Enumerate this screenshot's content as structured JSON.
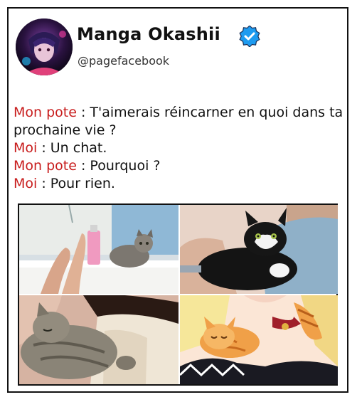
{
  "profile": {
    "name": "Manga Okashii",
    "handle": "@pagefacebook",
    "verified_icon": "verified-badge-icon",
    "avatar": "anime-character-avatar"
  },
  "post": {
    "lines": [
      {
        "speaker": "Mon pote",
        "text": " : T'aimerais réincarner en quoi dans ta prochaine vie ?"
      },
      {
        "speaker": "Moi",
        "text": " : Un chat."
      },
      {
        "speaker": "Mon pote",
        "text": " : Pourquoi ?"
      },
      {
        "speaker": "Moi",
        "text": " : Pour rien."
      }
    ]
  },
  "colors": {
    "speaker": "#c81d1d",
    "verified": "#1d9bf0",
    "text": "#111111"
  },
  "images": [
    {
      "name": "cat-in-bathtub-photo"
    },
    {
      "name": "cat-in-shirt-photo"
    },
    {
      "name": "cat-on-chest-photo"
    },
    {
      "name": "anime-cat-on-chest-image"
    }
  ]
}
